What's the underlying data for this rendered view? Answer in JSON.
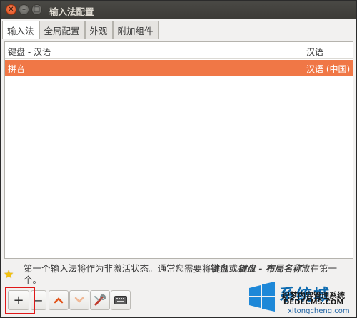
{
  "window": {
    "title": "输入法配置"
  },
  "tabs": [
    {
      "label": "输入法",
      "active": true
    },
    {
      "label": "全局配置",
      "active": false
    },
    {
      "label": "外观",
      "active": false
    },
    {
      "label": "附加组件",
      "active": false
    }
  ],
  "list": {
    "header_left": "键盘 - 汉语",
    "header_right": "汉语",
    "rows": [
      {
        "name": "拼音",
        "language": "汉语 (中国)",
        "selected": true
      }
    ]
  },
  "info": {
    "prefix": "第一个输入法将作为非激活状态。通常您需要将",
    "bold1": "键盘",
    "mid": "或",
    "bold2": "键盘 - 布局名称",
    "suffix": "放在第一个。"
  },
  "toolbar": {
    "add_label": "+",
    "remove_label": "−",
    "icons": [
      "up-arrow-icon",
      "down-arrow-icon",
      "configure-icon",
      "keyboard-icon"
    ]
  },
  "watermark": {
    "brand": "系统城",
    "site": "织梦内容管理系统",
    "domain": "DEDECMS.COM",
    "url": "xitongcheng.com"
  },
  "colors": {
    "selection": "#f07746",
    "titlebar": "#3c3b37",
    "close": "#df4a16"
  }
}
